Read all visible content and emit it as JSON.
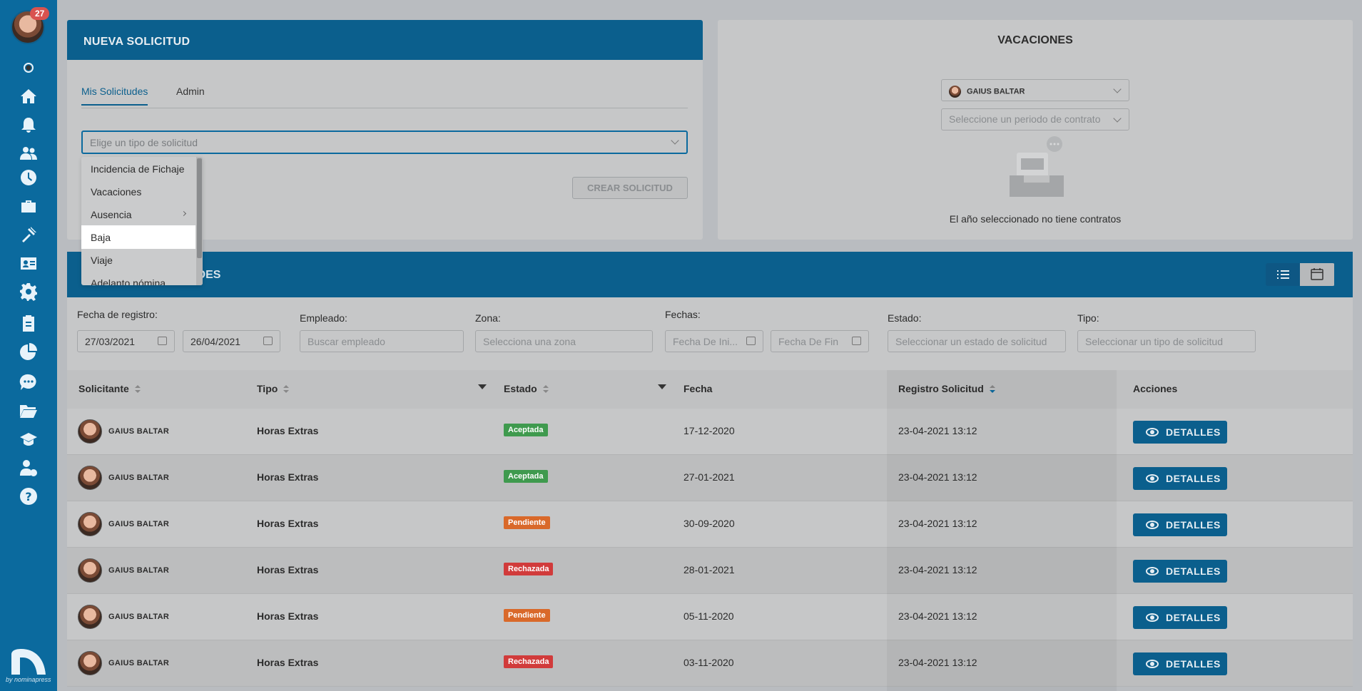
{
  "sidebar": {
    "notification_count": "27",
    "logo_caption": "by nominapress",
    "icons": [
      "status-dot-icon",
      "home-icon",
      "bell-icon",
      "users-icon",
      "clock-icon",
      "briefcase-icon",
      "tools-icon",
      "id-card-icon",
      "gear-icon",
      "clipboard-icon",
      "pie-chart-icon",
      "chat-icon",
      "folder-icon",
      "graduation-icon",
      "user-money-icon",
      "help-icon"
    ]
  },
  "nueva_solicitud": {
    "title": "NUEVA SOLICITUD",
    "tabs": [
      {
        "label": "Mis Solicitudes",
        "active": true
      },
      {
        "label": "Admin",
        "active": false
      }
    ],
    "type_select_placeholder": "Elige un tipo de solicitud",
    "create_button": "CREAR SOLICITUD",
    "dropdown_options": [
      "Incidencia de Fichaje",
      "Vacaciones",
      "Ausencia",
      "Baja",
      "Viaje",
      "Adelanto nómina"
    ],
    "hovered_option": "Baja"
  },
  "vacaciones": {
    "title": "VACACIONES",
    "employee_select": "GAIUS BALTAR",
    "contract_placeholder": "Seleccione un periodo de contrato",
    "empty_message": "El año seleccionado no tiene contratos"
  },
  "solicitudes": {
    "title_visible": "UDES",
    "filters": {
      "fecha_registro_label": "Fecha de registro:",
      "fecha_desde": "27/03/2021",
      "fecha_hasta": "26/04/2021",
      "empleado_label": "Empleado:",
      "empleado_placeholder": "Buscar empleado",
      "zona_label": "Zona:",
      "zona_placeholder": "Selecciona una zona",
      "fechas_label": "Fechas:",
      "fecha_inicio_placeholder": "Fecha De Ini...",
      "fecha_fin_placeholder": "Fecha De Fin",
      "estado_label": "Estado:",
      "estado_placeholder": "Seleccionar un estado de solicitud",
      "tipo_label": "Tipo:",
      "tipo_placeholder": "Seleccionar un tipo de solicitud"
    },
    "columns": [
      "Solicitante",
      "Tipo",
      "Estado",
      "Fecha",
      "Registro Solicitud",
      "Acciones"
    ],
    "rows": [
      {
        "name": "GAIUS BALTAR",
        "tipo": "Horas Extras",
        "estado": "Aceptada",
        "fecha": "17-12-2020",
        "registro": "23-04-2021 13:12",
        "accion": "DETALLES"
      },
      {
        "name": "GAIUS BALTAR",
        "tipo": "Horas Extras",
        "estado": "Aceptada",
        "fecha": "27-01-2021",
        "registro": "23-04-2021 13:12",
        "accion": "DETALLES"
      },
      {
        "name": "GAIUS BALTAR",
        "tipo": "Horas Extras",
        "estado": "Pendiente",
        "fecha": "30-09-2020",
        "registro": "23-04-2021 13:12",
        "accion": "DETALLES"
      },
      {
        "name": "GAIUS BALTAR",
        "tipo": "Horas Extras",
        "estado": "Rechazada",
        "fecha": "28-01-2021",
        "registro": "23-04-2021 13:12",
        "accion": "DETALLES"
      },
      {
        "name": "GAIUS BALTAR",
        "tipo": "Horas Extras",
        "estado": "Pendiente",
        "fecha": "05-11-2020",
        "registro": "23-04-2021 13:12",
        "accion": "DETALLES"
      },
      {
        "name": "GAIUS BALTAR",
        "tipo": "Horas Extras",
        "estado": "Rechazada",
        "fecha": "03-11-2020",
        "registro": "23-04-2021 13:12",
        "accion": "DETALLES"
      }
    ],
    "status_colors": {
      "Aceptada": "#3f9a4e",
      "Pendiente": "#d9692a",
      "Rechazada": "#d13b3b"
    }
  },
  "colors": {
    "primary": "#0b6a9e",
    "header": "#0b5f8d"
  }
}
